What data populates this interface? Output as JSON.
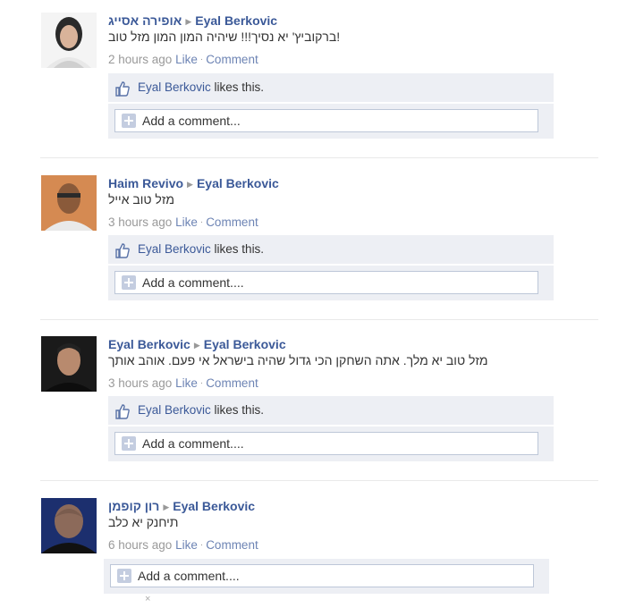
{
  "stories": [
    {
      "author": "אופירה אסייג",
      "target": "Eyal Berkovic",
      "message": "ברקוביץ' יא נסיך!!! שיהיה המון המון מזל טוב!",
      "time": "2 hours ago",
      "like_label": "Like",
      "comment_label": "Comment",
      "liker": "Eyal Berkovic",
      "likes_suffix": "likes this.",
      "add_comment": "Add a comment..."
    },
    {
      "author": "Haim Revivo",
      "target": "Eyal Berkovic",
      "message": "מזל טוב אייל",
      "time": "3 hours ago",
      "like_label": "Like",
      "comment_label": "Comment",
      "liker": "Eyal Berkovic",
      "likes_suffix": "likes this.",
      "add_comment": "Add a comment...."
    },
    {
      "author": "Eyal Berkovic",
      "target": "Eyal Berkovic",
      "message": "מזל טוב יא מלך. אתה השחקן הכי גדול שהיה בישראל אי פעם. אוהב אותך",
      "time": "3 hours ago",
      "like_label": "Like",
      "comment_label": "Comment",
      "liker": "Eyal Berkovic",
      "likes_suffix": "likes this.",
      "add_comment": "Add a comment...."
    },
    {
      "author": "רון קופמן",
      "target": "Eyal Berkovic",
      "message": "תיחנק יא כלב",
      "time": "6 hours ago",
      "like_label": "Like",
      "comment_label": "Comment",
      "add_comment": "Add a comment...."
    }
  ],
  "close_glyph": "×",
  "icons": {
    "like": "thumbs-up-icon",
    "add": "plus-icon",
    "separator": "triangle-right-icon"
  },
  "colors": {
    "link": "#3b5998",
    "ufi_bg": "#edeff4",
    "meta": "#999999"
  }
}
